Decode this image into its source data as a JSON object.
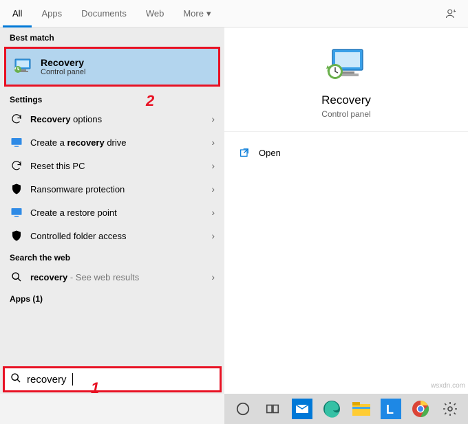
{
  "tabs": {
    "all": "All",
    "apps": "Apps",
    "documents": "Documents",
    "web": "Web",
    "more": "More"
  },
  "sections": {
    "best_match": "Best match",
    "settings": "Settings",
    "search_web": "Search the web",
    "apps_count": "Apps (1)"
  },
  "best": {
    "title": "Recovery",
    "sub": "Control panel"
  },
  "settings_items": [
    {
      "pre": "",
      "bold": "Recovery",
      "post": " options"
    },
    {
      "pre": "Create a ",
      "bold": "recovery",
      "post": " drive"
    },
    {
      "pre": "Reset this PC",
      "bold": "",
      "post": ""
    },
    {
      "pre": "Ransomware protection",
      "bold": "",
      "post": ""
    },
    {
      "pre": "Create a restore point",
      "bold": "",
      "post": ""
    },
    {
      "pre": "Controlled folder access",
      "bold": "",
      "post": ""
    }
  ],
  "web": {
    "term": "recovery",
    "suffix": " - See web results"
  },
  "search": {
    "value": "recovery"
  },
  "detail": {
    "title": "Recovery",
    "sub": "Control panel",
    "open": "Open"
  },
  "annotations": {
    "one": "1",
    "two": "2"
  },
  "watermark": "wsxdn.com"
}
